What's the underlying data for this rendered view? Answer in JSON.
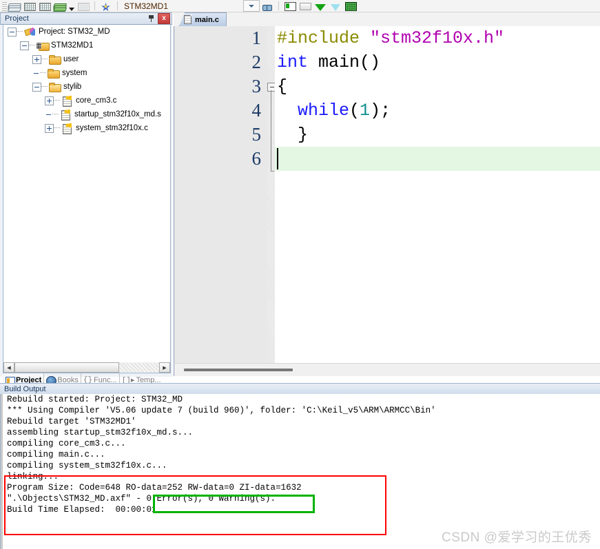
{
  "toolbar": {
    "target_name": "STM32MD1",
    "icons": [
      "book-stack-icon",
      "grid-icon",
      "grid-icon-2",
      "green-stack-icon",
      "dropdown-arrow-icon",
      "grid-disabled-icon",
      "blue-star-icon",
      "target-dropdown-caret-icon",
      "binoculars-icon",
      "panes-icon",
      "window-icon",
      "green-triangle-icon",
      "cyan-funnel-icon",
      "speckle-icon"
    ]
  },
  "project_panel": {
    "title": "Project",
    "pin_label": "",
    "close_label": "x",
    "tree": [
      {
        "label": "Project: STM32_MD",
        "indent": 0,
        "expander": "minus",
        "icon": "project-icon"
      },
      {
        "label": "STM32MD1",
        "indent": 1,
        "expander": "minus",
        "icon": "target-icon"
      },
      {
        "label": "user",
        "indent": 2,
        "expander": "plus",
        "icon": "folder-icon"
      },
      {
        "label": "system",
        "indent": 2,
        "expander": "none",
        "icon": "folder-icon"
      },
      {
        "label": "stylib",
        "indent": 2,
        "expander": "minus",
        "icon": "folder-open-icon"
      },
      {
        "label": "core_cm3.c",
        "indent": 3,
        "expander": "plus",
        "icon": "source-file-icon"
      },
      {
        "label": "startup_stm32f10x_md.s",
        "indent": 3,
        "expander": "none",
        "icon": "source-file-icon"
      },
      {
        "label": "system_stm32f10x.c",
        "indent": 3,
        "expander": "plus",
        "icon": "source-file-icon"
      }
    ],
    "tabs": [
      {
        "label": "Project",
        "icon": "project-tab-icon",
        "active": true
      },
      {
        "label": "Books",
        "icon": "books-icon",
        "active": false
      },
      {
        "label": "Func...",
        "icon": "braces-icon",
        "active": false
      },
      {
        "label": "Temp...",
        "icon": "template-icon",
        "active": false
      }
    ],
    "scroll_left_arrow": "◀",
    "scroll_right_arrow": "▶"
  },
  "editor": {
    "tab": {
      "label": "main.c",
      "icon": "document-icon"
    },
    "lines": [
      {
        "num": "1",
        "tokens": [
          {
            "t": "#include ",
            "c": "pre"
          },
          {
            "t": "\"stm32f10x.h\"",
            "c": "str"
          }
        ]
      },
      {
        "num": "2",
        "tokens": [
          {
            "t": "int",
            "c": "kw"
          },
          {
            "t": " main()",
            "c": "plain"
          }
        ]
      },
      {
        "num": "3",
        "tokens": [
          {
            "t": "{",
            "c": "plain"
          }
        ]
      },
      {
        "num": "4",
        "tokens": [
          {
            "t": "  ",
            "c": "plain"
          },
          {
            "t": "while",
            "c": "kw"
          },
          {
            "t": "(",
            "c": "plain"
          },
          {
            "t": "1",
            "c": "num"
          },
          {
            "t": ");",
            "c": "plain"
          }
        ]
      },
      {
        "num": "5",
        "tokens": [
          {
            "t": "  }",
            "c": "plain"
          }
        ]
      },
      {
        "num": "6",
        "tokens": [
          {
            "t": "",
            "c": "plain"
          }
        ]
      }
    ],
    "fold_marker_line": 3,
    "current_line": 6
  },
  "build_output": {
    "title": "Build Output",
    "lines": [
      "Rebuild started: Project: STM32_MD",
      "*** Using Compiler 'V5.06 update 7 (build 960)', folder: 'C:\\Keil_v5\\ARM\\ARMCC\\Bin'",
      "Rebuild target 'STM32MD1'",
      "assembling startup_stm32f10x_md.s...",
      "compiling core_cm3.c...",
      "compiling main.c...",
      "compiling system_stm32f10x.c...",
      "linking...",
      "Program Size: Code=648 RO-data=252 RW-data=0 ZI-data=1632",
      "\".\\Objects\\STM32_MD.axf\" - 0 Error(s), 0 Warning(s).",
      "Build Time Elapsed:  00:00:01"
    ],
    "highlight_red_label": "build-result-red-highlight",
    "highlight_green_label": "zero-errors-green-highlight"
  },
  "watermark": {
    "text": "CSDN @爱学习的王优秀"
  },
  "colors": {
    "preprocessor": "#8a8a00",
    "string": "#b000b0",
    "keyword": "#1a1aff",
    "number": "#0f8f8f",
    "current_line_bg": "#e3f7e3",
    "red_highlight": "#ff0000",
    "green_highlight": "#00b300",
    "panel_title": "#17365d"
  }
}
